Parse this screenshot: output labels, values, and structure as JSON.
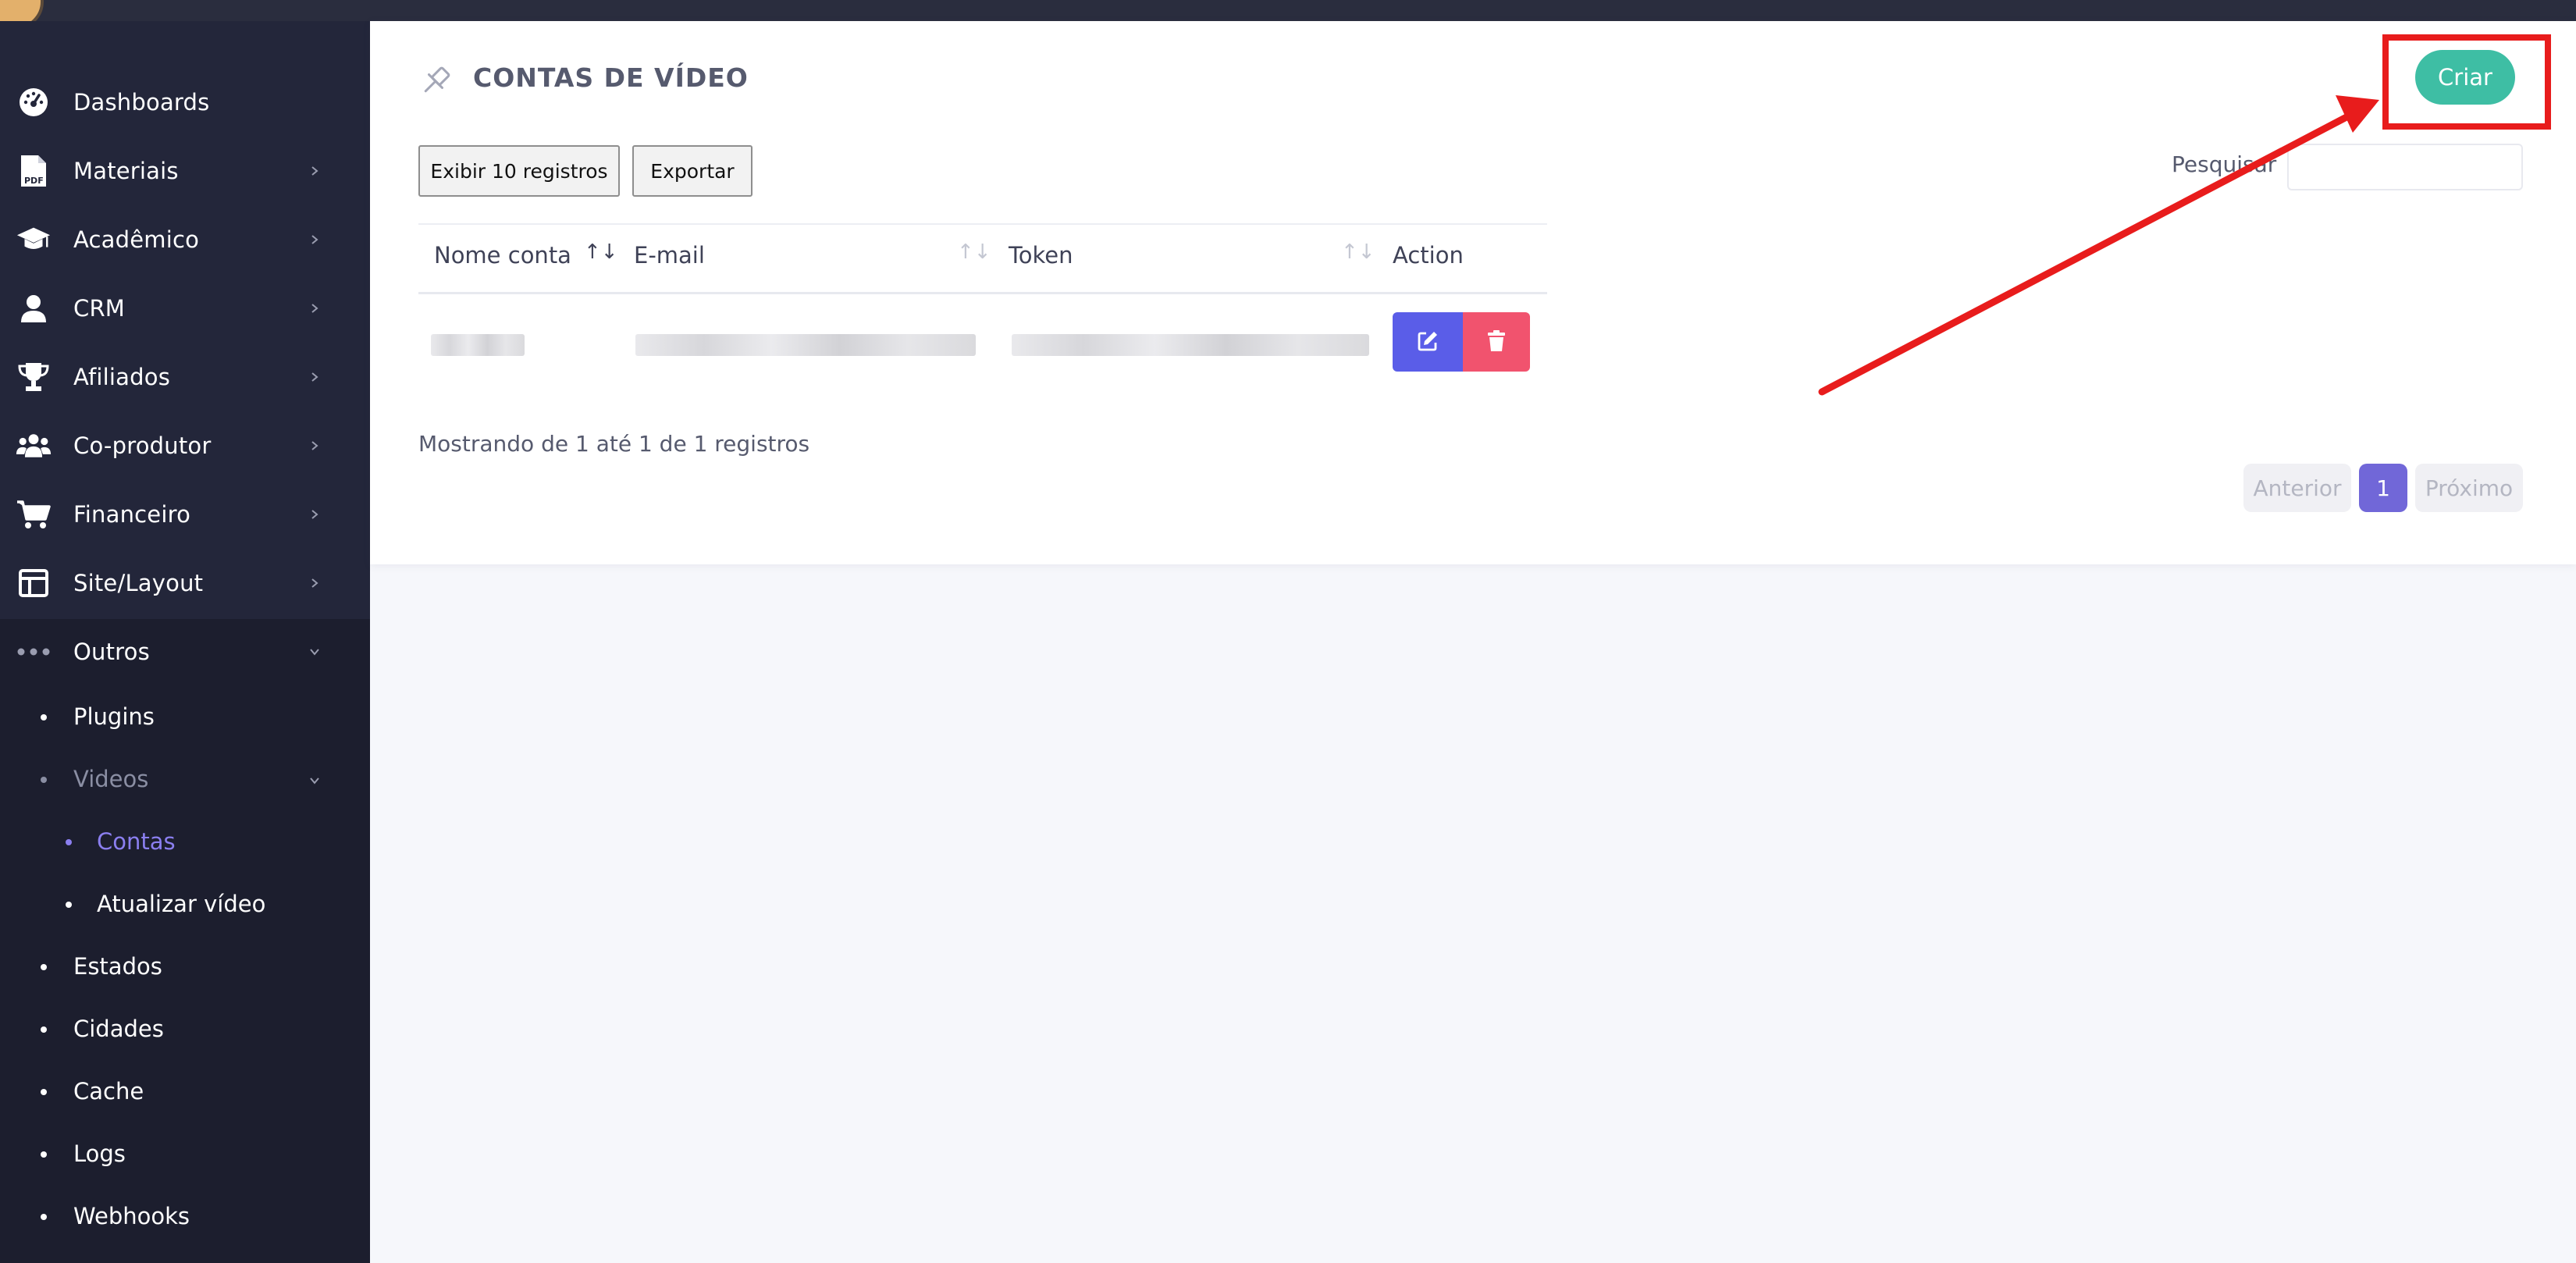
{
  "sidebar": {
    "items": [
      {
        "label": "Dashboards",
        "icon": "dashboard-gauge-icon"
      },
      {
        "label": "Materiais",
        "icon": "pdf-file-icon"
      },
      {
        "label": "Acadêmico",
        "icon": "graduation-cap-icon"
      },
      {
        "label": "CRM",
        "icon": "user-icon"
      },
      {
        "label": "Afiliados",
        "icon": "trophy-icon"
      },
      {
        "label": "Co-produtor",
        "icon": "users-icon"
      },
      {
        "label": "Financeiro",
        "icon": "shopping-cart-icon"
      },
      {
        "label": "Site/Layout",
        "icon": "layout-icon"
      },
      {
        "label": "Outros",
        "icon": "more-dots-icon"
      }
    ],
    "outros_sub": [
      {
        "label": "Plugins"
      },
      {
        "label": "Videos"
      },
      {
        "label": "Estados"
      },
      {
        "label": "Cidades"
      },
      {
        "label": "Cache"
      },
      {
        "label": "Logs"
      },
      {
        "label": "Webhooks"
      }
    ],
    "videos_sub": [
      {
        "label": "Contas",
        "active": true
      },
      {
        "label": "Atualizar vídeo"
      }
    ]
  },
  "page": {
    "title": "CONTAS DE VÍDEO",
    "create_label": "Criar",
    "show_records_label": "Exibir 10 registros",
    "export_label": "Exportar",
    "search_label": "Pesquisar",
    "search_value": ""
  },
  "table": {
    "columns": [
      "Nome conta",
      "E-mail",
      "Token",
      "Action"
    ],
    "rows": [
      {
        "nome_conta": "",
        "email": "",
        "token": ""
      }
    ]
  },
  "pagination": {
    "info": "Mostrando de 1 até 1 de 1 registros",
    "prev_label": "Anterior",
    "current_page": "1",
    "next_label": "Próximo"
  },
  "colors": {
    "sidebar_bg": "#23263a",
    "accent_green": "#3ebea4",
    "accent_purple": "#7167d8",
    "edit_blue": "#5a5de8",
    "delete_red": "#f1536e",
    "annotation_red": "#e81c1c"
  }
}
